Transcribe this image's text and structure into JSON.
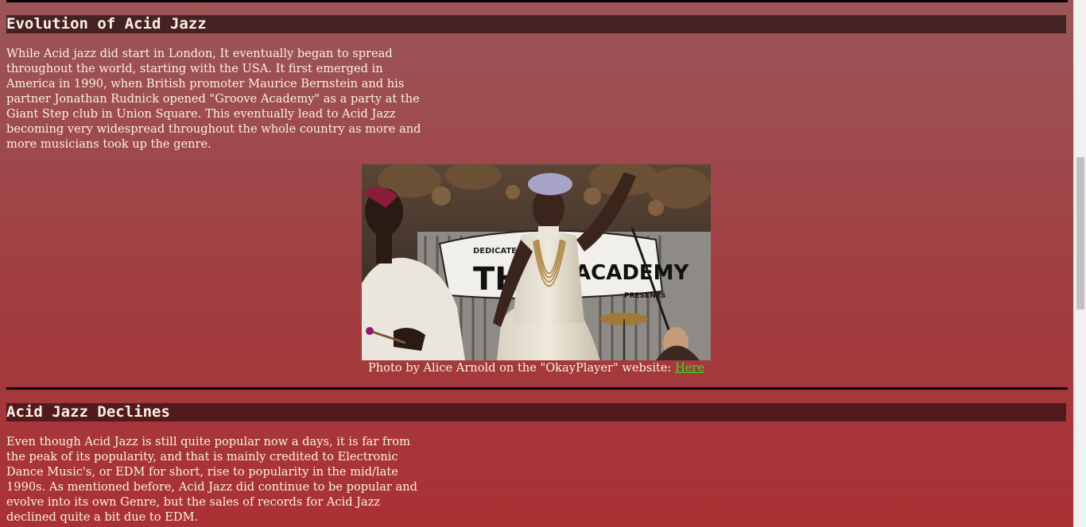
{
  "section1": {
    "heading": "Evolution of Acid Jazz",
    "paragraph": "While Acid jazz did start in London, It eventually began to spread throughout the world, starting with the USA. It first emerged in America in 1990, when British promoter Maurice Bernstein and his partner Jonathan Rudnick opened \"Groove Academy\" as a party at the Giant Step club in Union Square. This eventually lead to Acid Jazz becoming very widespread throughout the whole country as more and more musicians took up the genre.",
    "photo_caption": "Photo by Alice Arnold on the \"OkayPlayer\" website: ",
    "photo_link": "Here",
    "photo_sign": {
      "line1": "DEDICATED",
      "line2": "THE",
      "line3": "ACADEMY",
      "line4": "PRESENTS"
    }
  },
  "section2": {
    "heading": "Acid Jazz Declines",
    "paragraph": "Even though Acid Jazz is still quite popular now a days, it is far from the peak of its popularity, and that is mainly credited to Electronic Dance Music's, or EDM for short, rise to popularity in the mid/late 1990s. As mentioned before, Acid Jazz did continue to be popular and evolve into its own Genre, but the sales of records for Acid Jazz declined quite a bit due to EDM."
  },
  "scroll": {
    "position_fraction": 0.3
  },
  "colors": {
    "link": "#39e21f",
    "heading_bg_1": "#442224",
    "heading_bg_2": "#511a1c",
    "text": "#fbf1e0"
  }
}
